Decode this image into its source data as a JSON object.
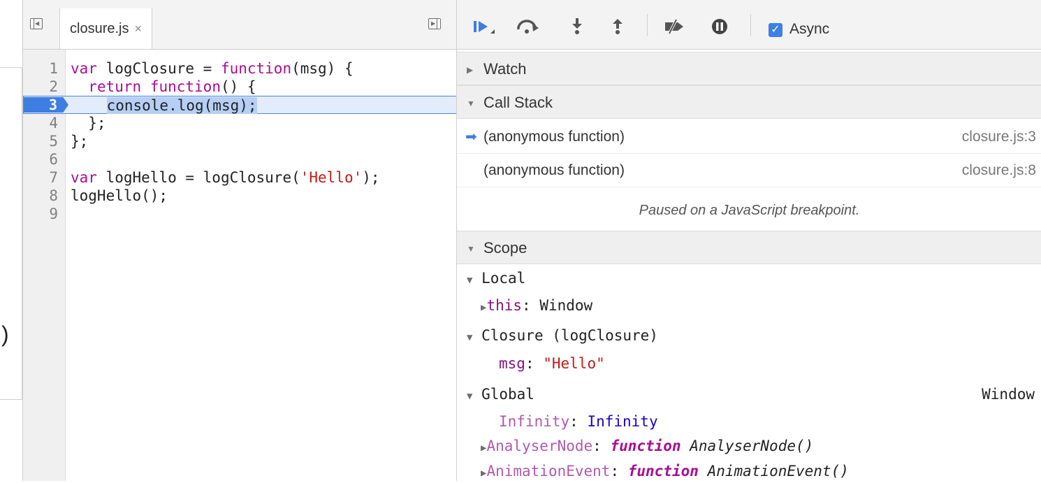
{
  "editor": {
    "file_tab": "closure.js",
    "close_glyph": "×",
    "lines": [
      {
        "num": "1",
        "parts": [
          [
            "kw",
            "var"
          ],
          [
            "t",
            " logClosure = "
          ],
          [
            "kw",
            "function"
          ],
          [
            "t",
            "(msg) {"
          ]
        ]
      },
      {
        "num": "2",
        "parts": [
          [
            "t",
            "  "
          ],
          [
            "kw",
            "return"
          ],
          [
            "t",
            " "
          ],
          [
            "kw",
            "function"
          ],
          [
            "t",
            "() {"
          ]
        ]
      },
      {
        "num": "3",
        "parts": [
          [
            "t",
            "    console.log(msg);"
          ]
        ]
      },
      {
        "num": "4",
        "parts": [
          [
            "t",
            "  };"
          ]
        ]
      },
      {
        "num": "5",
        "parts": [
          [
            "t",
            "};"
          ]
        ]
      },
      {
        "num": "6",
        "parts": []
      },
      {
        "num": "7",
        "parts": [
          [
            "kw",
            "var"
          ],
          [
            "t",
            " logHello = logClosure("
          ],
          [
            "str",
            "'Hello'"
          ],
          [
            "t",
            ");"
          ]
        ]
      },
      {
        "num": "8",
        "parts": [
          [
            "t",
            "logHello();"
          ]
        ]
      },
      {
        "num": "9",
        "parts": []
      }
    ],
    "breakpoint_line": "3"
  },
  "toolbar": {
    "async_label": "Async",
    "async_checked": true
  },
  "sections": {
    "watch": "Watch",
    "call_stack": "Call Stack",
    "scope": "Scope"
  },
  "call_stack": {
    "frames": [
      {
        "name": "(anonymous function)",
        "location": "closure.js:3",
        "current": true
      },
      {
        "name": "(anonymous function)",
        "location": "closure.js:8",
        "current": false
      }
    ],
    "paused_message": "Paused on a JavaScript breakpoint."
  },
  "scope": {
    "local": {
      "label": "Local",
      "items": [
        {
          "name": "this",
          "value": "Window"
        }
      ]
    },
    "closure": {
      "label": "Closure (logClosure)",
      "items": [
        {
          "name": "msg",
          "value": "\"Hello\""
        }
      ]
    },
    "global": {
      "label": "Global",
      "value": "Window",
      "items": [
        {
          "name": "Infinity",
          "value": "Infinity"
        },
        {
          "name": "AnalyserNode",
          "value_kw": "function",
          "value": "AnalyserNode()"
        },
        {
          "name": "AnimationEvent",
          "value_kw": "function",
          "value": "AnimationEvent()"
        }
      ]
    }
  },
  "colors": {
    "accent": "#3e7ee0",
    "keyword": "#aa0d91",
    "string": "#c41a16"
  }
}
